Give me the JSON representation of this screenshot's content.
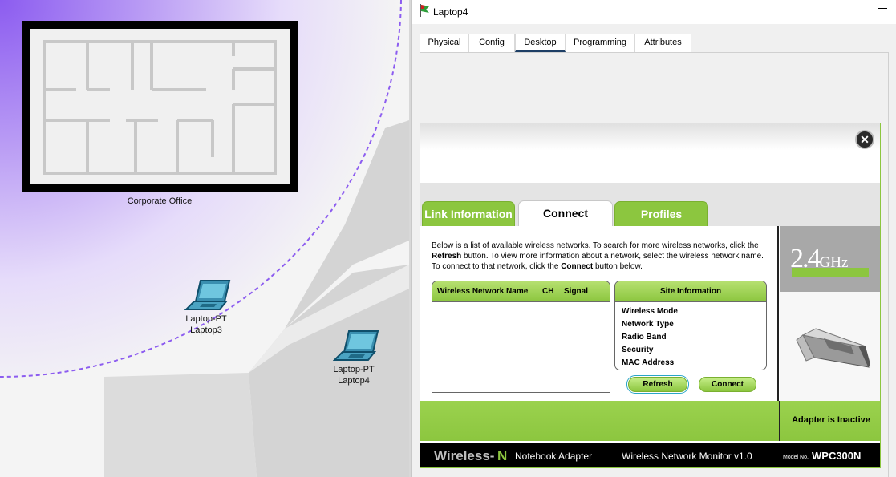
{
  "workspace": {
    "building_label": "Corporate Office",
    "devices": [
      {
        "type": "Laptop-PT",
        "name": "Laptop3"
      },
      {
        "type": "Laptop-PT",
        "name": "Laptop4"
      }
    ]
  },
  "window": {
    "title": "Laptop4",
    "tabs": [
      {
        "label": "Physical"
      },
      {
        "label": "Config"
      },
      {
        "label": "Desktop"
      },
      {
        "label": "Programming"
      },
      {
        "label": "Attributes"
      }
    ],
    "active_tab": "Desktop"
  },
  "monitor": {
    "tabs": [
      {
        "label": "Link Information"
      },
      {
        "label": "Connect"
      },
      {
        "label": "Profiles"
      }
    ],
    "active_tab": "Connect",
    "intro": {
      "p1": "Below is a list of available wireless networks. To search for more wireless networks, click the ",
      "b1": "Refresh",
      "p2": " button. To view more information about a network, select the wireless network name. To connect to that network, click the ",
      "b2": "Connect",
      "p3": " button below."
    },
    "network_table": {
      "columns": [
        "Wireless Network Name",
        "CH",
        "Signal"
      ],
      "rows": []
    },
    "site_info": {
      "title": "Site Information",
      "fields": [
        "Wireless Mode",
        "Network Type",
        "Radio Band",
        "Security",
        "MAC Address"
      ]
    },
    "buttons": {
      "refresh": "Refresh",
      "connect": "Connect"
    },
    "band": {
      "number": "2.4",
      "unit": "GHz"
    },
    "status": "Adapter is Inactive",
    "footer": {
      "brand": "Wireless-",
      "brand_n": "N",
      "product": "Notebook Adapter",
      "app": "Wireless Network Monitor  v1.0",
      "model_no_label": "Model No.",
      "model": "WPC300N"
    }
  },
  "colors": {
    "accent_green": "#8cc63f",
    "range_purple": "#8c5cf0",
    "tab_underline": "#1e3f66"
  }
}
